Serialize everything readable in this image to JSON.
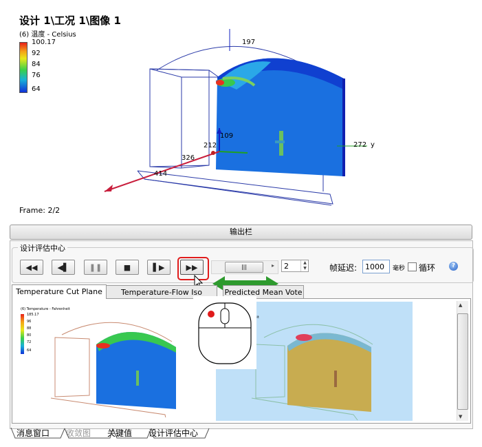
{
  "viewport": {
    "title": "设计 1\\工况 1\\图像 1",
    "subtitle": "(6) 温度 - Celsius",
    "legend_ticks": [
      "100.17",
      "92",
      "84",
      "76",
      "64"
    ],
    "frame": "Frame: 2/2",
    "dimension_labels": [
      "197",
      "109",
      "212",
      "326",
      "414",
      "272"
    ],
    "axis_y": "y"
  },
  "output_bar": {
    "label": "输出栏"
  },
  "center": {
    "group_label": "设计评估中心",
    "buttons": {
      "rewind": "◀◀",
      "step_back": "◀▌",
      "pause": "❚❚",
      "stop": "■",
      "step_forward": "▌▶",
      "fast_forward": "▶▶"
    },
    "slider_grip": "|||",
    "spin_value": "2",
    "delay_label": "帧延迟:",
    "delay_value": "1000",
    "ms_label": "毫秒",
    "loop_label": "循环",
    "help": "?"
  },
  "tabs": [
    {
      "label": "Temperature Cut Plane"
    },
    {
      "label": "Temperature-Flow Iso Surface"
    },
    {
      "label": "Predicted Mean Vote"
    }
  ],
  "thumbnails": [
    {
      "subtitle": "(6) Temperature - Fahrenheit",
      "ticks": [
        "185.17",
        "96",
        "88",
        "80",
        "72",
        "64"
      ]
    },
    {
      "subtitle": "nheit"
    }
  ],
  "bottom_tabs": [
    {
      "label": "消息窗口"
    },
    {
      "label": "收敛图"
    },
    {
      "label": "关键值"
    },
    {
      "label": "设计评估中心"
    }
  ],
  "colors": {
    "highlight": "#e01b1b",
    "arrow": "#2e9a2e",
    "mouse_button": "#e01b1b"
  }
}
